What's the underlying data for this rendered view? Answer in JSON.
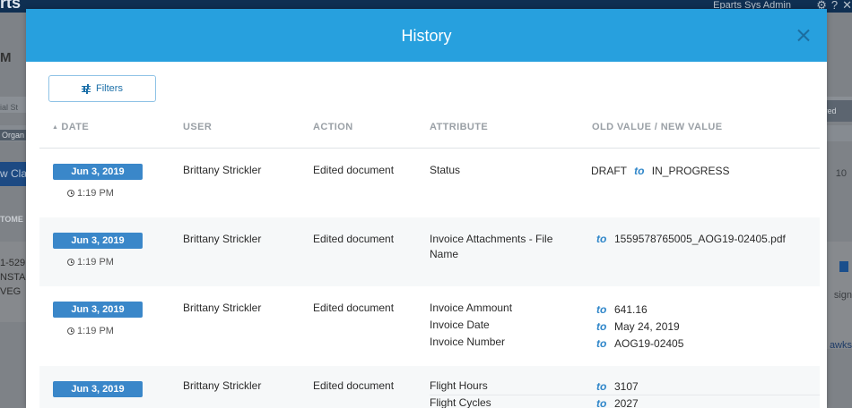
{
  "background": {
    "logo": "rts",
    "user": "Eparts Sys Admin",
    "page_title_fragment": "M",
    "crumb_1": "ial St",
    "crumb_2": "Organ",
    "new_button_fragment": "w Cla",
    "customer_label_fragment": "TOME",
    "card_lines": [
      "1-529",
      "NSTAL",
      "VEG"
    ],
    "right_saved_fragment": "ved",
    "right_number_fragment": "10",
    "right_assign_fragment": "sign",
    "right_hawks_fragment": "awks"
  },
  "modal": {
    "title": "History",
    "filters_label": "Filters",
    "columns": {
      "date": "DATE",
      "user": "USER",
      "action": "ACTION",
      "attribute": "ATTRIBUTE",
      "values": "OLD VALUE / NEW VALUE"
    },
    "to_label": "to",
    "rows": [
      {
        "date": "Jun 3, 2019",
        "time": "1:19 PM",
        "user": "Brittany Strickler",
        "action": "Edited document",
        "status_attr": "Status",
        "old": "DRAFT",
        "new": "IN_PROGRESS"
      },
      {
        "date": "Jun 3, 2019",
        "time": "1:19 PM",
        "user": "Brittany Strickler",
        "action": "Edited document",
        "attr": "Invoice Attachments - File Name",
        "new": "1559578765005_AOG19-02405.pdf"
      },
      {
        "date": "Jun 3, 2019",
        "time": "1:19 PM",
        "user": "Brittany Strickler",
        "action": "Edited document",
        "changes": [
          {
            "attr": "Invoice Ammount",
            "new": "641.16"
          },
          {
            "attr": "Invoice Date",
            "new": "May 24, 2019"
          },
          {
            "attr": "Invoice Number",
            "new": "AOG19-02405"
          }
        ]
      },
      {
        "date": "Jun 3, 2019",
        "user": "Brittany Strickler",
        "action": "Edited document",
        "changes": [
          {
            "attr": "Flight Hours",
            "new": "3107"
          },
          {
            "attr": "Flight Cycles",
            "new": "2027"
          }
        ]
      }
    ]
  }
}
